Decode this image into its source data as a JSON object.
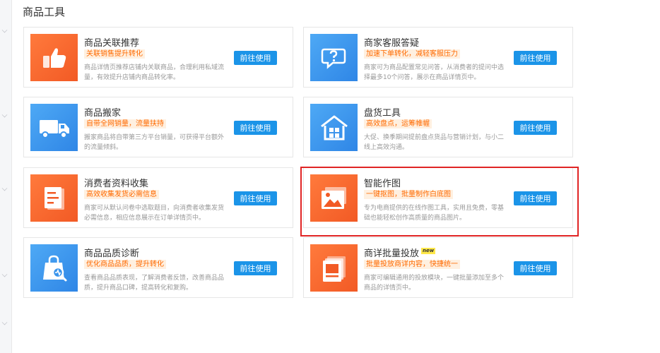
{
  "section": {
    "title": "商品工具"
  },
  "colors": {
    "accent": "#1b94e8",
    "tag_text": "#ff6a00",
    "tag_bg": "#fff0e0",
    "highlight": "#e02424",
    "orange": "#f25a25",
    "blue": "#2f86e6"
  },
  "tools": [
    {
      "name": "商品关联推荐",
      "tag": "关联销售提升转化",
      "desc": "商品详情页推荐店铺内关联商品，合理利用私域流量，有效提升店铺内商品转化率。",
      "button": "前往使用",
      "icon": "thumbs-up-icon",
      "color": "orange"
    },
    {
      "name": "商家客服答疑",
      "tag": "加速下单转化，减轻客服压力",
      "desc": "商家可为商品配置常见问答，从消费者的提问中选择最多10个问答，展示在商品详情页中。",
      "button": "前往使用",
      "icon": "question-chat-icon",
      "color": "blue"
    },
    {
      "name": "商品搬家",
      "tag": "自带全网销量，流量扶持",
      "desc": "搬家商品将自带第三方平台销量，可获得平台额外的流量倾斜。",
      "button": "前往使用",
      "icon": "delivery-truck-icon",
      "color": "blue"
    },
    {
      "name": "盘货工具",
      "tag": "高效盘点，运筹帷幄",
      "desc": "大促、换季期间提前盘点货品与营销计划，与小二线上高效沟通。",
      "button": "前往使用",
      "icon": "warehouse-icon",
      "color": "blue"
    },
    {
      "name": "消费者资料收集",
      "tag": "高效收集发货必需信息",
      "desc": "商家可从默认问卷中选取题目，向消费者收集发货必需信息，相应信息展示在订单详情页中。",
      "button": "前往使用",
      "icon": "document-icon",
      "color": "orange"
    },
    {
      "name": "智能作图",
      "tag": "一键抠图，批量制作白底图",
      "desc": "专为电商提供的在线作图工具，实用且免费，零基础也能轻松创作高质量的商品图片。",
      "button": "前往使用",
      "icon": "image-icon",
      "color": "orange"
    },
    {
      "name": "商品品质诊断",
      "tag": "优化商品品质，提升转化",
      "desc": "查看商品品质表现，了解消费者反馈，改善商品品质，提升商品口碑，提高转化和复购。",
      "button": "前往使用",
      "icon": "shopping-bag-search-icon",
      "color": "blue"
    },
    {
      "name": "商详批量投放",
      "badge": "new",
      "tag": "批量投放商详内容，快捷统一",
      "desc": "商家可编辑通用的投放模块，一键批量添加至多个商品的详情页中。",
      "button": "前往使用",
      "icon": "picture-stack-icon",
      "color": "orange"
    }
  ]
}
